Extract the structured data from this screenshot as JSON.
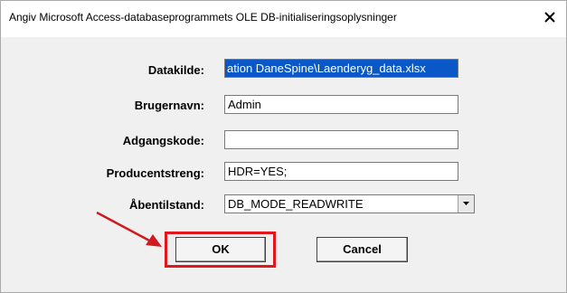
{
  "window": {
    "title": "Angiv Microsoft Access-databaseprogrammets OLE DB-initialiseringsoplysninger"
  },
  "form": {
    "datakilde": {
      "label": "Datakilde:",
      "value": "ation DaneSpine\\Laenderyg_data.xlsx"
    },
    "brugernavn": {
      "label": "Brugernavn:",
      "value": "Admin"
    },
    "adgangskode": {
      "label": "Adgangskode:",
      "value": ""
    },
    "producentstreng": {
      "label": "Producentstreng:",
      "value": "HDR=YES;"
    },
    "abentilstand": {
      "label": "Åbentilstand:",
      "value": "DB_MODE_READWRITE"
    }
  },
  "buttons": {
    "ok": "OK",
    "cancel": "Cancel"
  },
  "colors": {
    "highlight": "#e0171c",
    "selection": "#0a57c8"
  }
}
